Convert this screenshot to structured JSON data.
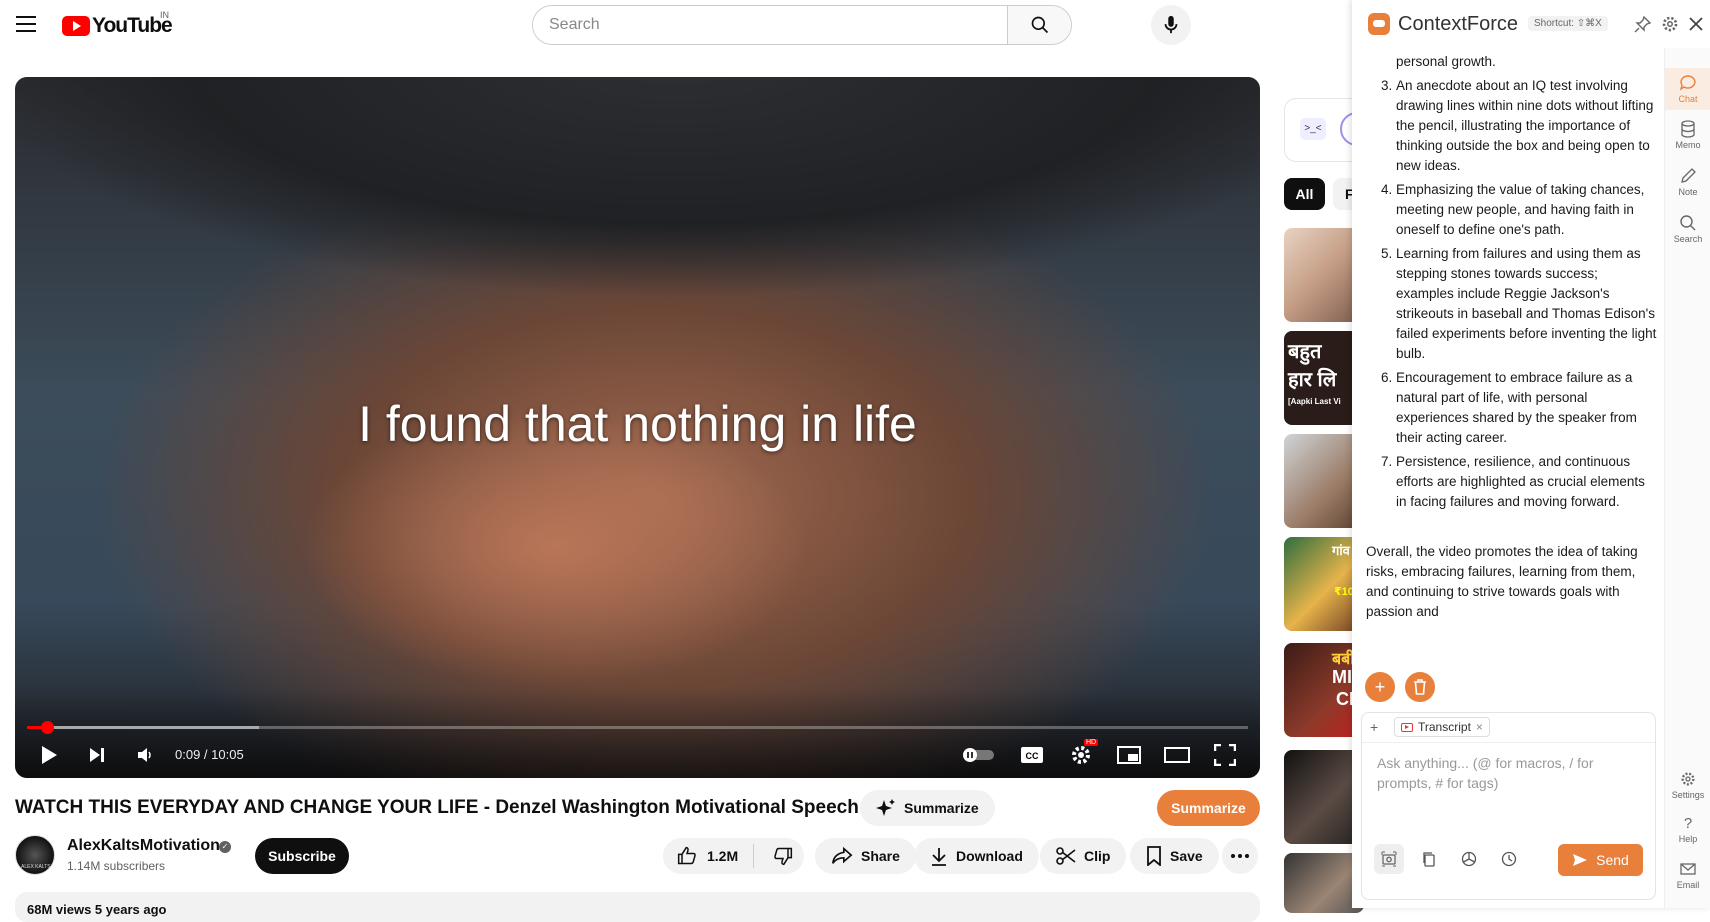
{
  "header": {
    "logo_text": "YouTube",
    "country": "IN",
    "search_placeholder": "Search"
  },
  "player": {
    "subtitle": "I found that nothing in life",
    "time": "0:09 / 10:05",
    "played_fraction": 0.016,
    "buffered_fraction": 0.19,
    "hd_badge": "HD"
  },
  "video": {
    "title": "WATCH THIS EVERYDAY AND CHANGE YOUR LIFE - Denzel Washington Motivational Speech",
    "summarize_label": "Summarize",
    "summarize_orange_label": "Summarize",
    "channel_name": "AlexKaltsMotivation",
    "avatar_text": "ALEX KALTS",
    "subscribers": "1.14M subscribers",
    "subscribe_label": "Subscribe",
    "likes": "1.2M",
    "share_label": "Share",
    "download_label": "Download",
    "clip_label": "Clip",
    "save_label": "Save",
    "description_preview": "68M views  5 years ago"
  },
  "sidebar": {
    "chip_all": "All",
    "chip_2": "F",
    "thumb_texts": [
      "बहुत",
      "हार लि",
      "[Aapki Last Vi",
      "गांव",
      "₹10",
      "बबी",
      "MI",
      "CI"
    ]
  },
  "contextforce": {
    "title": "ContextForce",
    "shortcut": "Shortcut: ⇧⌘X",
    "summary_start_text": "life such as education, career choices, and personal growth.",
    "points": [
      "An anecdote about an IQ test involving drawing lines within nine dots without lifting the pencil, illustrating the importance of thinking outside the box and being open to new ideas.",
      "Emphasizing the value of taking chances, meeting new people, and having faith in oneself to define one's path.",
      "Learning from failures and using them as stepping stones towards success; examples include Reggie Jackson's strikeouts in baseball and Thomas Edison's failed experiments before inventing the light bulb.",
      "Encouragement to embrace failure as a natural part of life, with personal experiences shared by the speaker from their acting career.",
      "Persistence, resilience, and continuous efforts are highlighted as crucial elements in facing failures and moving forward."
    ],
    "overall": "Overall, the video promotes the idea of taking risks, embracing failures, learning from them, and continuing to strive towards goals with passion and",
    "context_tag": "Transcript",
    "input_placeholder": "Ask anything... (@ for macros, / for prompts, # for tags)",
    "send_label": "Send",
    "rail": {
      "chat": "Chat",
      "memo": "Memo",
      "note": "Note",
      "search": "Search",
      "settings": "Settings",
      "help": "Help",
      "email": "Email"
    },
    "accent_color": "#e87f3a"
  }
}
